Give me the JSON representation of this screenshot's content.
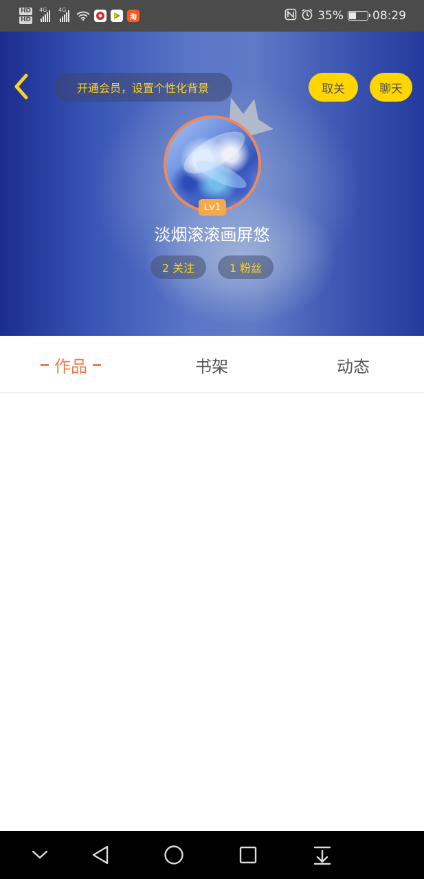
{
  "status_bar": {
    "hd_top": "HD",
    "hd_bottom": "HD",
    "network_1": "4G",
    "network_2": "4G",
    "app_badge_3": "淘",
    "battery_percent": "35%",
    "battery_level": 0.35,
    "time": "08:29"
  },
  "header": {
    "vip_prompt": "开通会员，设置个性化背景",
    "unfollow_label": "取关",
    "chat_label": "聊天",
    "level": "Lv1",
    "username": "淡烟滚滚画屏悠",
    "following_label": "2 关注",
    "followers_label": "1 粉丝"
  },
  "tabs": {
    "works": "作品",
    "bookshelf": "书架",
    "feed": "动态"
  },
  "icons": {
    "back": "chevron-left-icon",
    "crown": "crown-icon",
    "nav_down": "chevron-down-icon",
    "nav_back": "triangle-back-icon",
    "nav_home": "circle-home-icon",
    "nav_recent": "square-recent-icon",
    "nav_notify": "pull-down-icon"
  },
  "colors": {
    "accent": "#f07a4a",
    "pill_yellow": "#ffd600",
    "vip_text": "#ffd21f",
    "status_bar_bg": "#4b4b4b"
  }
}
